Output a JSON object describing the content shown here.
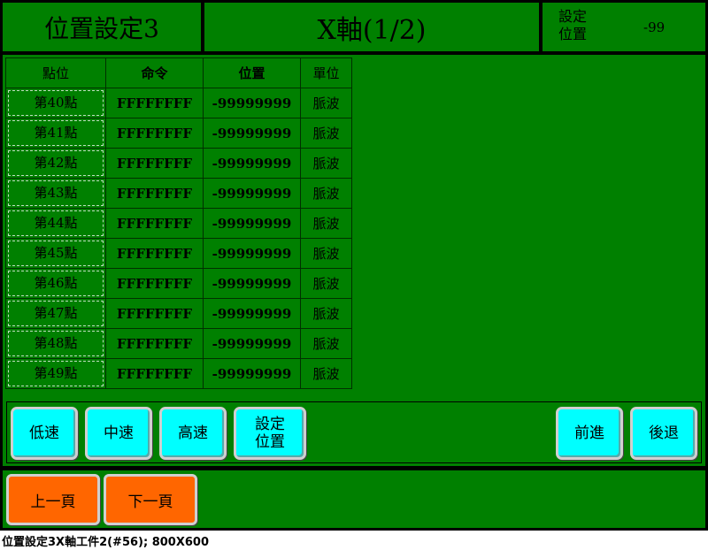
{
  "header": {
    "title": "位置設定3",
    "axis": "X軸(1/2)",
    "set_label": "設定位置",
    "set_value": "-99"
  },
  "table": {
    "columns": [
      "點位",
      "命令",
      "位置",
      "單位"
    ],
    "rows": [
      {
        "point": "第40點",
        "command": "FFFFFFFF",
        "position": "-99999999",
        "unit": "脈波"
      },
      {
        "point": "第41點",
        "command": "FFFFFFFF",
        "position": "-99999999",
        "unit": "脈波"
      },
      {
        "point": "第42點",
        "command": "FFFFFFFF",
        "position": "-99999999",
        "unit": "脈波"
      },
      {
        "point": "第43點",
        "command": "FFFFFFFF",
        "position": "-99999999",
        "unit": "脈波"
      },
      {
        "point": "第44點",
        "command": "FFFFFFFF",
        "position": "-99999999",
        "unit": "脈波"
      },
      {
        "point": "第45點",
        "command": "FFFFFFFF",
        "position": "-99999999",
        "unit": "脈波"
      },
      {
        "point": "第46點",
        "command": "FFFFFFFF",
        "position": "-99999999",
        "unit": "脈波"
      },
      {
        "point": "第47點",
        "command": "FFFFFFFF",
        "position": "-99999999",
        "unit": "脈波"
      },
      {
        "point": "第48點",
        "command": "FFFFFFFF",
        "position": "-99999999",
        "unit": "脈波"
      },
      {
        "point": "第49點",
        "command": "FFFFFFFF",
        "position": "-99999999",
        "unit": "脈波"
      }
    ]
  },
  "speed_buttons": {
    "low": "低速",
    "mid": "中速",
    "high": "高速",
    "set_position": "設定位置"
  },
  "jog_buttons": {
    "forward": "前進",
    "backward": "後退"
  },
  "footer": {
    "prev_page": "上一頁",
    "next_page": "下一頁"
  },
  "caption": "位置設定3X軸工件2(#56); 800X600",
  "colors": {
    "panel": "#008000",
    "cyan_button": "#00ffff",
    "orange_button": "#ff6600"
  }
}
